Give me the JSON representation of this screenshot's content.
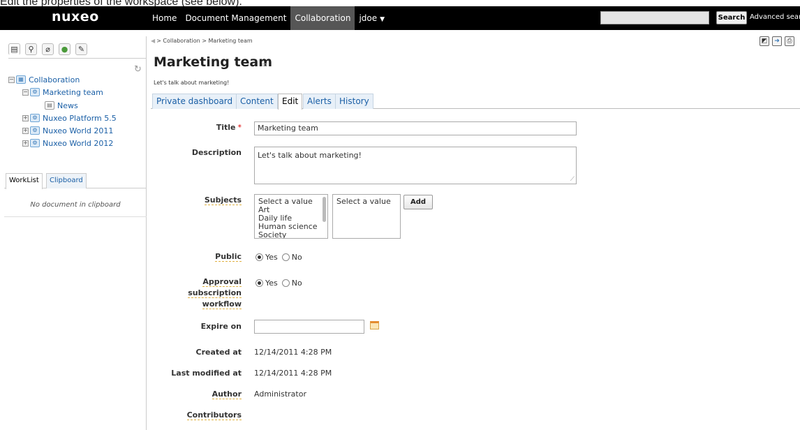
{
  "caption": "Edit the properties of the workspace (see below).",
  "topbar": {
    "logo": "nuxeo",
    "nav": [
      {
        "label": "Home"
      },
      {
        "label": "Document Management"
      },
      {
        "label": "Collaboration",
        "active": true
      },
      {
        "label": "jdoe"
      }
    ],
    "search_button": "Search",
    "advanced_search": "Advanced search"
  },
  "sidebar": {
    "tree": [
      {
        "label": "Collaboration",
        "icon": "database-icon"
      },
      {
        "label": "Marketing team",
        "icon": "workspace-icon"
      },
      {
        "label": "News",
        "icon": "document-icon"
      },
      {
        "label": "Nuxeo Platform 5.5",
        "icon": "workspace-icon"
      },
      {
        "label": "Nuxeo World 2011",
        "icon": "workspace-icon"
      },
      {
        "label": "Nuxeo World 2012",
        "icon": "workspace-icon"
      }
    ],
    "bottom_tabs": [
      "WorkList",
      "Clipboard"
    ],
    "clipboard_empty": "No document in clipboard"
  },
  "main": {
    "breadcrumb": "> Collaboration > Marketing team",
    "title": "Marketing team",
    "subtitle": "Let's talk about marketing!",
    "tabs": [
      "Private dashboard",
      "Content",
      "Edit",
      "Alerts",
      "History"
    ],
    "active_tab": "Edit"
  },
  "form": {
    "title_label": "Title",
    "title_value": "Marketing team",
    "description_label": "Description",
    "description_value": "Let's talk about marketing!",
    "subjects_label": "Subjects",
    "subjects_options": [
      "Select a value",
      "Art",
      "Daily life",
      "Human science",
      "Society"
    ],
    "subjects_selected_placeholder": "Select a value",
    "add_button": "Add",
    "public_label": "Public",
    "approval_label": "Approval subscription workflow",
    "yes_label": "Yes",
    "no_label": "No",
    "expire_label": "Expire on",
    "created_label": "Created at",
    "created_value": "12/14/2011 4:28 PM",
    "modified_label": "Last modified at",
    "modified_value": "12/14/2011 4:28 PM",
    "author_label": "Author",
    "author_value": "Administrator",
    "contributors_label": "Contributors"
  },
  "colors": {
    "topbar_bg": "#000000",
    "active_nav_bg": "#565656",
    "link": "#1a5fa6"
  }
}
